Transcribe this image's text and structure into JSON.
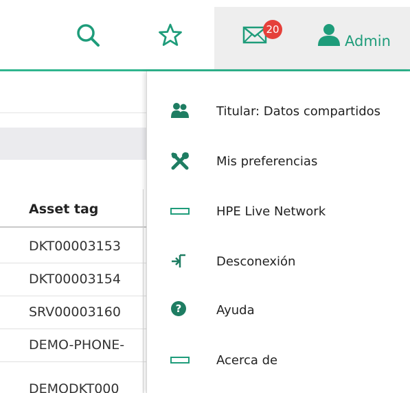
{
  "header": {
    "icons": [
      "search-icon",
      "star-icon",
      "mail-icon",
      "user-icon"
    ],
    "mail_count": "20",
    "user_label": "Admin",
    "accent_color": "#2fb58e",
    "badge_color": "#e5403a"
  },
  "table": {
    "column_header": "Asset tag",
    "rows": [
      "DKT00003153",
      "DKT00003154",
      "SRV00003160",
      "DEMO-PHONE-",
      "DEMODKT000"
    ]
  },
  "menu": {
    "items": [
      {
        "label": "Titular: Datos compartidos",
        "icon": "users-icon"
      },
      {
        "label": "Mis preferencias",
        "icon": "tools-icon"
      },
      {
        "label": "HPE Live Network",
        "icon": "rectangle-icon"
      },
      {
        "label": "Desconexión",
        "icon": "logout-icon"
      },
      {
        "label": "Ayuda",
        "icon": "help-icon"
      },
      {
        "label": "Acerca de",
        "icon": "rectangle-icon"
      }
    ]
  }
}
